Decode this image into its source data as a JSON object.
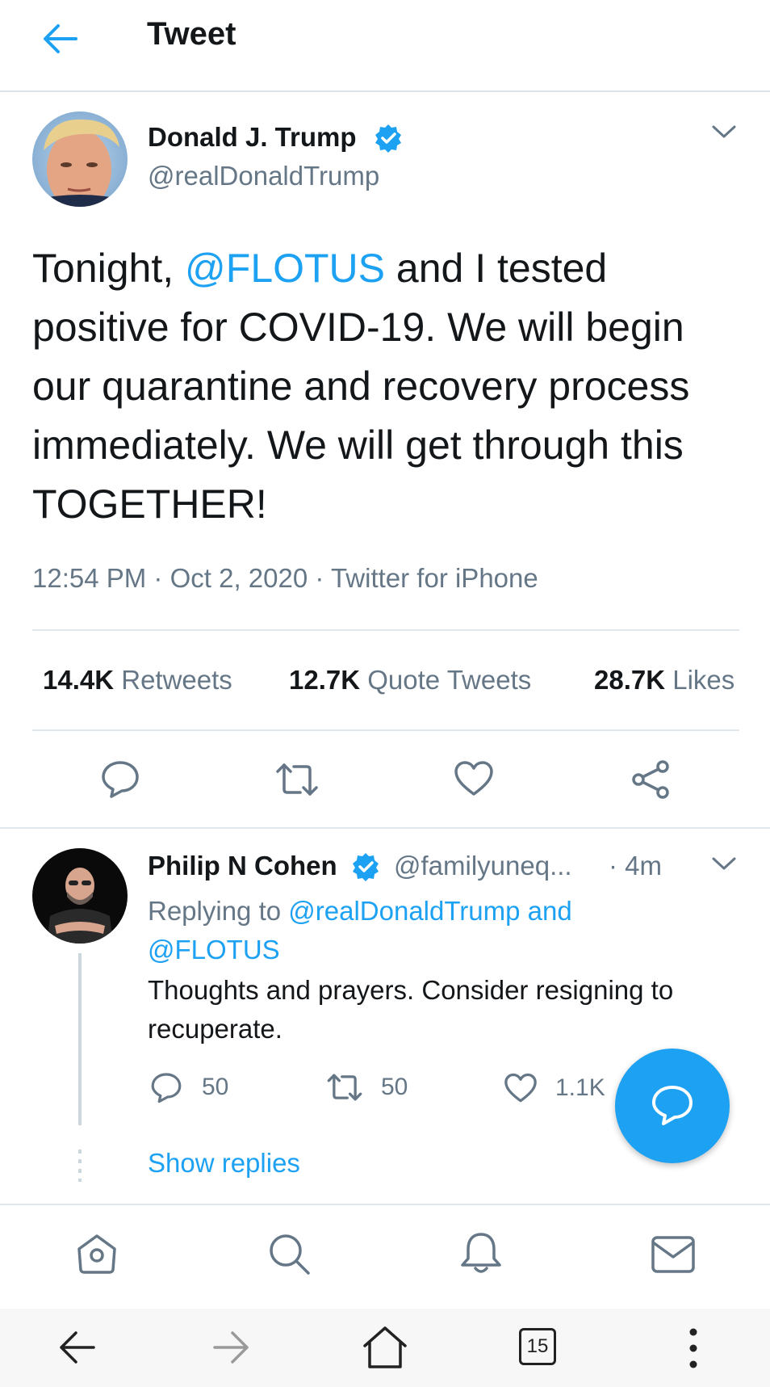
{
  "header": {
    "title": "Tweet",
    "back_icon": "arrow-left-icon"
  },
  "tweet": {
    "author": {
      "name": "Donald J. Trump",
      "handle": "@realDonaldTrump",
      "verified": true
    },
    "text_parts": {
      "before_mention": "Tonight, ",
      "mention": "@FLOTUS",
      "after_mention": " and I tested positive for COVID-19. We will begin our quarantine and recovery process immediately. We will get through this TOGETHER!"
    },
    "time": "12:54 PM",
    "date": "Oct 2, 2020",
    "source": "Twitter for iPhone",
    "separator": "·",
    "stats": {
      "retweets_count": "14.4K",
      "retweets_label": "Retweets",
      "quotes_count": "12.7K",
      "quotes_label": "Quote Tweets",
      "likes_count": "28.7K",
      "likes_label": "Likes"
    },
    "actions": [
      "reply-icon",
      "retweet-icon",
      "like-icon",
      "share-icon"
    ]
  },
  "reply": {
    "author": {
      "name": "Philip N Cohen",
      "handle": "@familyuneq...",
      "verified": true
    },
    "time_sep": "·",
    "time": "4m",
    "replying_prefix": "Replying to ",
    "replying_mention1": "@realDonaldTrump",
    "replying_and": " and",
    "replying_mention2": "@FLOTUS",
    "text": "Thoughts and prayers. Consider resigning to recuperate.",
    "reply_count": "50",
    "retweet_count": "50",
    "like_count": "1.1K",
    "show_replies": "Show replies"
  },
  "tabbar": [
    "home-icon",
    "search-icon",
    "notifications-icon",
    "messages-icon"
  ],
  "browser": {
    "tabs_count": "15"
  },
  "colors": {
    "accent": "#1da1f2",
    "secondary_text": "#657786",
    "divider": "#e1e8ed"
  }
}
